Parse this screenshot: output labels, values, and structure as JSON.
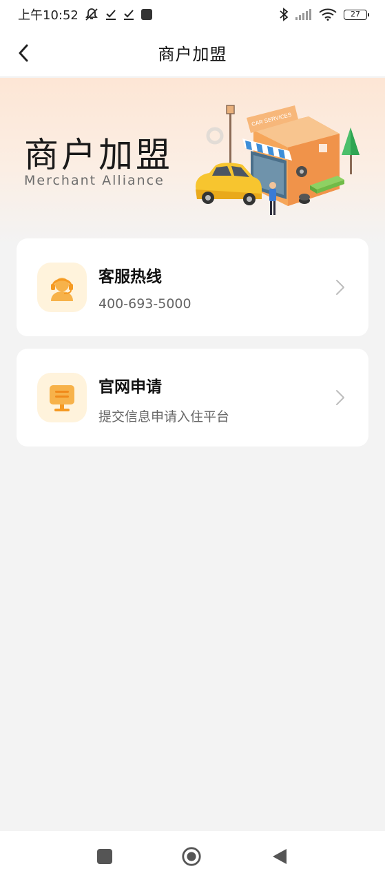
{
  "status_bar": {
    "time": "上午10:52",
    "battery": "27"
  },
  "nav": {
    "title": "商户加盟"
  },
  "banner": {
    "title": "商户加盟",
    "subtitle": "Merchant  Alliance",
    "sign_text": "CAR SERVICES"
  },
  "cards": [
    {
      "title": "客服热线",
      "subtitle": "400-693-5000",
      "icon": "headset-agent-icon"
    },
    {
      "title": "官网申请",
      "subtitle": "提交信息申请入住平台",
      "icon": "monitor-icon"
    }
  ],
  "colors": {
    "accent": "#f5a623",
    "icon_bg": "#fff3dc",
    "banner_top": "#fde6d5",
    "page_bg": "#f3f3f3"
  }
}
